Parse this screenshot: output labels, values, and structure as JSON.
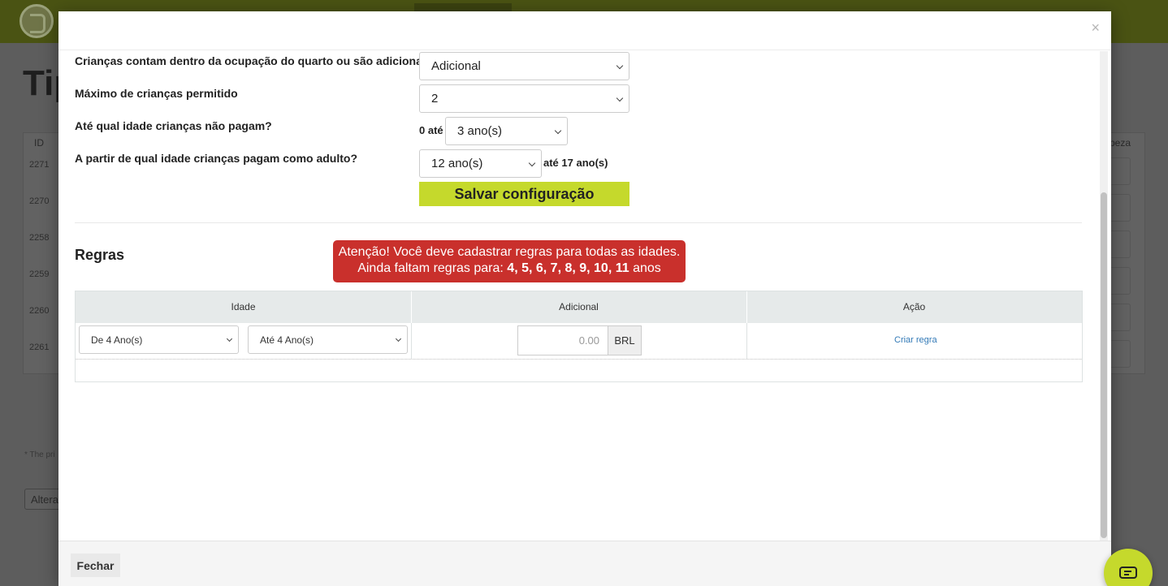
{
  "background": {
    "heading": "Tip",
    "table_header_id": "ID",
    "table_header_right": "peza",
    "row_ids": [
      "2271",
      "2270",
      "2258",
      "2259",
      "2260",
      "2261"
    ],
    "note": "* The pri",
    "button_label": "Altera"
  },
  "modal": {
    "close_symbol": "×",
    "questions": {
      "q1_label": "Crianças contam dentro da ocupação do quarto ou são adicionais?",
      "q1_value": "Adicional",
      "q2_label": "Máximo de crianças permitido",
      "q2_value": "2",
      "q3_label": "Até qual idade crianças não pagam?",
      "q3_prefix": "0 até",
      "q3_value": "3 ano(s)",
      "q4_label": "A partir de qual idade crianças pagam como adulto?",
      "q4_value": "12 ano(s)",
      "q4_suffix": "até 17 ano(s)"
    },
    "save_button": "Salvar configuração",
    "rules_title": "Regras",
    "alert": {
      "line1": "Atenção! Você deve cadastrar regras para todas as idades.",
      "line2_prefix": "Ainda faltam regras para:",
      "line2_ages": "4, 5, 6, 7, 8, 9, 10, 11",
      "line2_suffix": "anos"
    },
    "rules_table": {
      "headers": [
        "Idade",
        "Adicional",
        "Ação"
      ],
      "from_value": "De 4 Ano(s)",
      "to_value": "Até 4 Ano(s)",
      "amount_placeholder": "0.00",
      "currency": "BRL",
      "action_link": "Criar regra"
    },
    "footer_close": "Fechar"
  },
  "colors": {
    "accent": "#c5d92c",
    "alert": "#c9302c",
    "link": "#337ab7"
  }
}
